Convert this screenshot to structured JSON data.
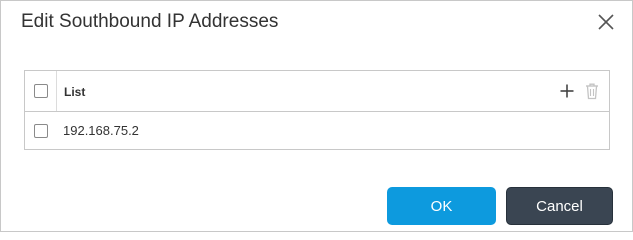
{
  "dialog": {
    "title": "Edit Southbound IP Addresses",
    "close_icon": "close-icon"
  },
  "table": {
    "header": {
      "label": "List"
    },
    "add_icon": "plus-icon",
    "delete_icon": "trash-icon",
    "rows": [
      {
        "value": "192.168.75.2",
        "checked": false
      }
    ]
  },
  "buttons": {
    "ok_label": "OK",
    "cancel_label": "Cancel"
  },
  "colors": {
    "ok": "#0d9ade",
    "cancel": "#3a4552"
  }
}
